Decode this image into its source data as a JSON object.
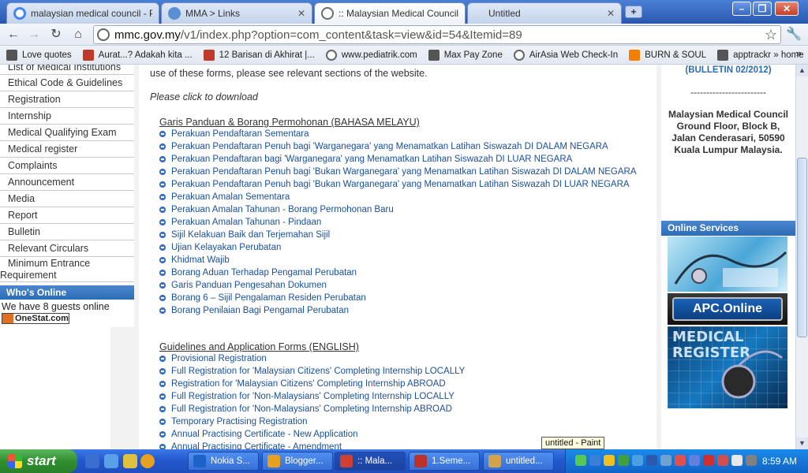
{
  "tabs": [
    {
      "title": "malaysian medical council - Per",
      "icon_color": "#4285f4"
    },
    {
      "title": "MMA > Links",
      "icon_color": "#5a8fd6"
    },
    {
      "title": ":: Malaysian Medical Council ::",
      "icon_color": "#6d6d6d"
    },
    {
      "title": "Untitled",
      "icon_color": ""
    }
  ],
  "toolbar": {
    "url_host": "mmc.gov.my",
    "url_path": "/v1/index.php?option=com_content&task=view&id=54&Itemid=89"
  },
  "bookmarks": [
    {
      "label": "Love quotes",
      "icon": "sparkle-icon",
      "color": "#555555"
    },
    {
      "label": "Aurat...? Adakah kita ...",
      "icon": "f-icon",
      "color": "#c0392b"
    },
    {
      "label": "12 Barisan di Akhirat |...",
      "icon": "f-icon",
      "color": "#c0392b"
    },
    {
      "label": "www.pediatrik.com",
      "icon": "globe-icon",
      "color": "#666666"
    },
    {
      "label": "Max Pay Zone",
      "icon": "sparkle-icon",
      "color": "#555555"
    },
    {
      "label": "AirAsia Web Check-In",
      "icon": "globe-icon",
      "color": "#666666"
    },
    {
      "label": "BURN & SOUL",
      "icon": "blogger-icon",
      "color": "#f57d00"
    },
    {
      "label": "apptrackr » home",
      "icon": "sparkle-icon",
      "color": "#555555"
    }
  ],
  "leftnav": {
    "items": [
      "List of Medical Institutions",
      "Ethical Code & Guidelines",
      "Registration",
      "Internship",
      "Medical Qualifying Exam",
      "Medical register",
      "Complaints",
      "Announcement",
      "Media",
      "Report",
      "Bulletin",
      "Relevant Circulars"
    ],
    "tall_item_line1": "Minimum Entrance",
    "tall_item_line2": "Requirement",
    "whos_online": "Who's Online",
    "guests": "We have 8 guests online",
    "onestat": "OneStat.com"
  },
  "main": {
    "intro": "use of these forms, please see relevant sections of the website.",
    "click": "Please click to download",
    "malay_head": "Garis Panduan & Borang Permohonan (BAHASA MELAYU)",
    "malay_links": [
      "Perakuan Pendaftaran Sementara",
      "Perakuan Pendaftaran Penuh bagi 'Warganegara' yang Menamatkan Latihan Siswazah DI DALAM NEGARA",
      "Perakuan Pendaftaran bagi 'Warganegara' yang Menamatkan Latihan Siswazah DI LUAR NEGARA",
      "Perakuan Pendaftaran Penuh bagi 'Bukan Warganegara' yang Menamatkan Latihan Siswazah DI DALAM NEGARA",
      "Perakuan Pendaftaran Penuh bagi 'Bukan Warganegara' yang Menamatkan Latihan Siswazah DI LUAR NEGARA",
      "Perakuan Amalan Sementara",
      "Perakuan Amalan Tahunan - Borang Permohonan Baru",
      "Perakuan Amalan Tahunan - Pindaan",
      "Sijil Kelakuan Baik dan Terjemahan Sijil",
      "Ujian Kelayakan Perubatan",
      "Khidmat Wajib",
      "Borang Aduan Terhadap Pengamal Perubatan",
      "Garis Panduan Pengesahan Dokumen",
      "Borang 6 – Sijil Pengalaman Residen Perubatan",
      "Borang Penilaian Bagi Pengamal Perubatan"
    ],
    "english_head": "Guidelines and Application Forms (ENGLISH)",
    "english_links": [
      "Provisional Registration",
      "Full Registration for 'Malaysian Citizens' Completing Internship LOCALLY",
      "Registration for 'Malaysian Citizens' Completing Internship ABROAD",
      "Full Registration for 'Non-Malaysians' Completing Internship LOCALLY",
      "Full Registration for 'Non-Malaysians' Completing Internship ABROAD",
      "Temporary Practising Registration",
      "Annual Practising Certificate - New Application",
      "Annual Practising Certificate - Amendment"
    ]
  },
  "right": {
    "bulletin": "(BULLETIN 02/2012)",
    "dashes": "------------------------",
    "address_lines": [
      "Malaysian Medical Council",
      "Ground Floor, Block B,",
      "Jalan Cenderasari, 50590",
      "Kuala Lumpur Malaysia."
    ],
    "online_services": "Online Services",
    "apc_label": "APC.Online",
    "medical_register_label": "MEDICAL REGISTER"
  },
  "tooltip": "untitled - Paint",
  "taskbar": {
    "start": "start",
    "tasks": [
      {
        "label": "Nokia S...",
        "color": "#1c63c8"
      },
      {
        "label": "Blogger...",
        "color": "#e8a020"
      },
      {
        "label": ":: Mala...",
        "color": "#d04030"
      },
      {
        "label": "1.Seme...",
        "color": "#c0302a"
      },
      {
        "label": "untitled...",
        "color": "#d4a24a"
      }
    ],
    "clock": "8:59 AM"
  }
}
